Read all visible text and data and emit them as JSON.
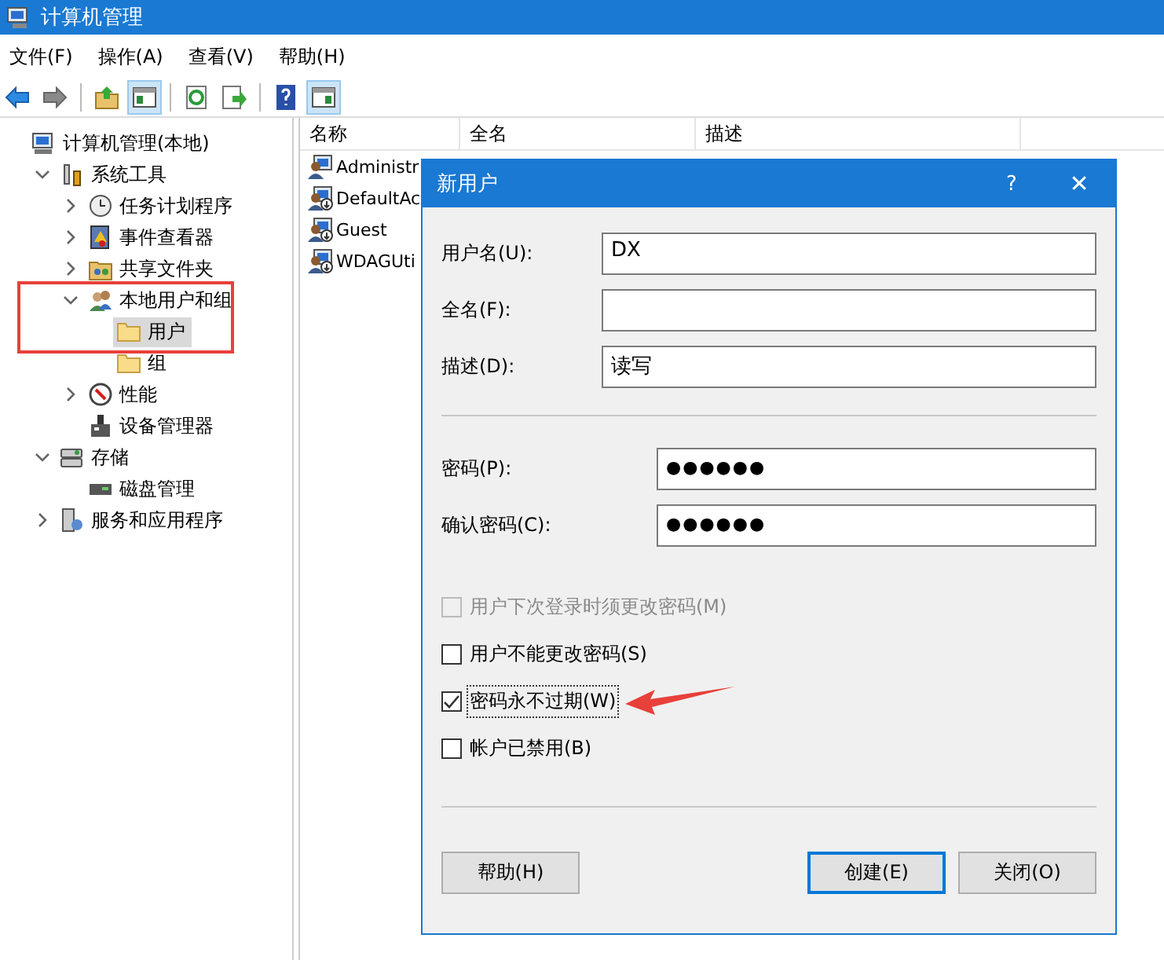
{
  "window": {
    "title": "计算机管理"
  },
  "menu": [
    "文件(F)",
    "操作(A)",
    "查看(V)",
    "帮助(H)"
  ],
  "toolbar": [
    {
      "kind": "back",
      "pressed": false
    },
    {
      "kind": "forward",
      "pressed": false
    },
    {
      "kind": "sep"
    },
    {
      "kind": "folder-up",
      "pressed": false
    },
    {
      "kind": "tree-pane",
      "pressed": true
    },
    {
      "kind": "sep"
    },
    {
      "kind": "refresh",
      "pressed": false
    },
    {
      "kind": "export",
      "pressed": false
    },
    {
      "kind": "sep"
    },
    {
      "kind": "help",
      "pressed": false
    },
    {
      "kind": "action-pane",
      "pressed": true
    }
  ],
  "tree": [
    {
      "label": "计算机管理(本地)",
      "kind": "computer",
      "selected": false,
      "children": [
        {
          "label": "系统工具",
          "kind": "tools",
          "expanded": true,
          "selected": false,
          "children": [
            {
              "label": "任务计划程序",
              "kind": "clock",
              "expanded": false,
              "selected": false
            },
            {
              "label": "事件查看器",
              "kind": "log",
              "expanded": false,
              "selected": false
            },
            {
              "label": "共享文件夹",
              "kind": "share",
              "expanded": false,
              "selected": false
            },
            {
              "label": "本地用户和组",
              "kind": "users",
              "expanded": true,
              "selected": false,
              "children": [
                {
                  "label": "用户",
                  "kind": "folder",
                  "selected": true
                },
                {
                  "label": "组",
                  "kind": "folder",
                  "selected": false
                }
              ]
            },
            {
              "label": "性能",
              "kind": "gauge",
              "expanded": false,
              "selected": false
            },
            {
              "label": "设备管理器",
              "kind": "device",
              "selected": false
            }
          ]
        },
        {
          "label": "存储",
          "kind": "storage",
          "expanded": true,
          "selected": false,
          "children": [
            {
              "label": "磁盘管理",
              "kind": "disk",
              "selected": false
            }
          ]
        },
        {
          "label": "服务和应用程序",
          "kind": "services",
          "expanded": false,
          "selected": false
        }
      ]
    }
  ],
  "list": {
    "columns": [
      "名称",
      "全名",
      "描述"
    ],
    "rows": [
      {
        "name": "Administr",
        "kind": "admin"
      },
      {
        "name": "DefaultAc",
        "kind": "user"
      },
      {
        "name": "Guest",
        "kind": "user"
      },
      {
        "name": "WDAGUti",
        "kind": "user"
      }
    ]
  },
  "dialog": {
    "title": "新用户",
    "help": "?",
    "close": "✕",
    "fields": [
      {
        "label": "用户名(U):",
        "value": "DX",
        "kind": "text"
      },
      {
        "label": "全名(F):",
        "kind": "text"
      },
      {
        "label": "描述(D):",
        "value": "读写",
        "kind": "text"
      },
      {
        "label": "密码(P):",
        "value": "●●●●●●",
        "kind": "password"
      },
      {
        "label": "确认密码(C):",
        "value": "●●●●●●",
        "kind": "password"
      }
    ],
    "checkboxes": [
      {
        "label": "用户下次登录时须更改密码(M)",
        "checked": false,
        "disabled": true,
        "focused": false
      },
      {
        "label": "用户不能更改密码(S)",
        "checked": false,
        "disabled": false,
        "focused": false
      },
      {
        "label": "密码永不过期(W)",
        "checked": true,
        "disabled": false,
        "focused": true
      },
      {
        "label": "帐户已禁用(B)",
        "checked": false,
        "disabled": false,
        "focused": false
      }
    ],
    "buttons": [
      {
        "label": "帮助(H)",
        "default": false
      },
      {
        "label": "创建(E)",
        "default": true
      },
      {
        "label": "关闭(O)",
        "default": false
      }
    ]
  }
}
